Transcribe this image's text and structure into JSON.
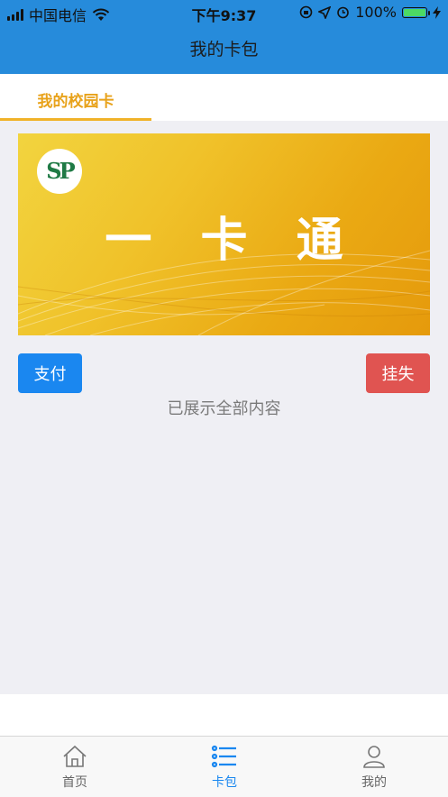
{
  "status_bar": {
    "carrier": "中国电信",
    "time": "下午9:37",
    "battery_percent": "100%",
    "battery_level": 1.0
  },
  "nav": {
    "title": "我的卡包"
  },
  "tabs": [
    {
      "label": "我的校园卡",
      "active": true
    }
  ],
  "card": {
    "title": "一 卡 通",
    "logo_text": "SP",
    "colors": {
      "gradient_start": "#f2d43f",
      "gradient_end": "#e59a0c"
    }
  },
  "actions": {
    "pay_label": "支付",
    "report_lost_label": "挂失"
  },
  "end_note": "已展示全部内容",
  "tab_bar": [
    {
      "label": "首页",
      "icon": "home-icon",
      "active": false
    },
    {
      "label": "卡包",
      "icon": "list-icon",
      "active": true
    },
    {
      "label": "我的",
      "icon": "user-icon",
      "active": false
    }
  ],
  "colors": {
    "header_blue": "#268bdb",
    "accent_gold": "#e8a21a",
    "pay_blue": "#1a87f0",
    "lost_red": "#e05451"
  }
}
